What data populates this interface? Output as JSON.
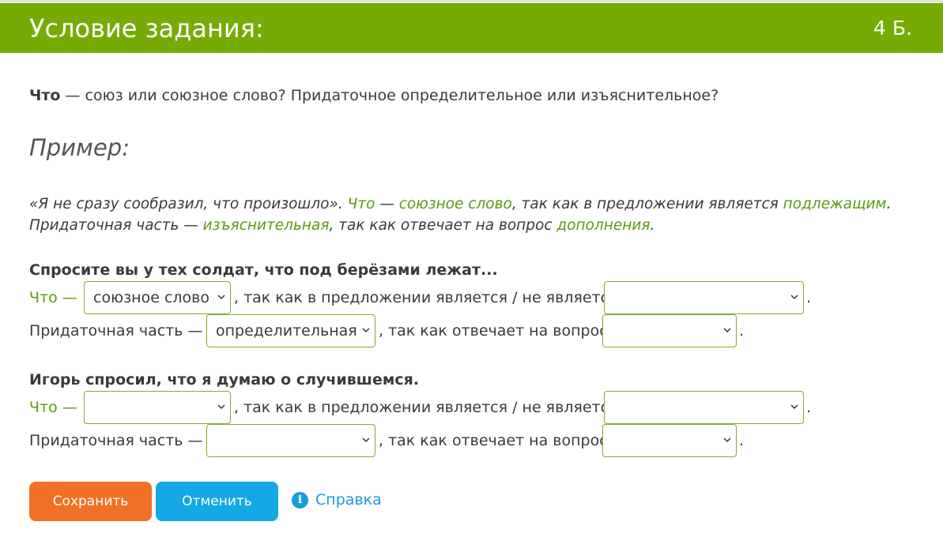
{
  "header": {
    "title": "Условие задания:",
    "points": "4 Б."
  },
  "question": {
    "bold": "Что",
    "text": " — союз или союзное слово? Придаточное определительное или изъяснительное?"
  },
  "example": {
    "heading": "Пример:",
    "line1": [
      {
        "t": "«Я не сразу сообразил, что произошло». ",
        "green": false
      },
      {
        "t": "Что",
        "green": true
      },
      {
        "t": " — ",
        "green": false
      },
      {
        "t": "союзное слово",
        "green": true
      },
      {
        "t": ", так как в предложении является ",
        "green": false
      },
      {
        "t": "подлежащим",
        "green": true
      },
      {
        "t": ".",
        "green": false
      }
    ],
    "line2": [
      {
        "t": "Придаточная часть — ",
        "green": false
      },
      {
        "t": "изъяснительная",
        "green": true
      },
      {
        "t": ", так как отвечает на вопрос ",
        "green": false
      },
      {
        "t": "дополнения",
        "green": true
      },
      {
        "t": ".",
        "green": false
      }
    ]
  },
  "sentences": [
    {
      "title": "Спросите вы у тех солдат, что под берёзами лежат...",
      "row1": {
        "lead": "Что —",
        "mid": ", так как в предложении является / не является",
        "end": "."
      },
      "row2": {
        "lead": "Придаточная часть —",
        "mid": ", так как отвечает на вопрос",
        "end": "."
      },
      "select_type": "союзное слово",
      "select_role": "",
      "select_clause": "определительная",
      "select_question": ""
    },
    {
      "title": "Игорь спросил, что я думаю о случившемся.",
      "row1": {
        "lead": "Что —",
        "mid": ", так как в предложении является / не является",
        "end": "."
      },
      "row2": {
        "lead": "Придаточная часть —",
        "mid": ", так как отвечает на вопрос",
        "end": "."
      },
      "select_type": "",
      "select_role": "",
      "select_clause": "",
      "select_question": ""
    }
  ],
  "buttons": {
    "save": "Сохранить",
    "cancel": "Отменить"
  },
  "help": {
    "icon": "info-icon",
    "label": "Справка"
  },
  "colors": {
    "header": "#76ab05",
    "accent_green": "#5a9b10",
    "save": "#f07026",
    "cancel": "#14a8e4",
    "link": "#1a9bd7"
  }
}
